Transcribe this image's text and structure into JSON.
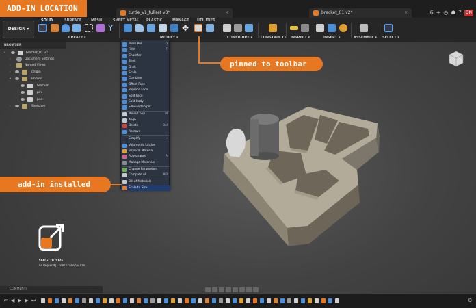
{
  "overlay": {
    "title_callout": "ADD-IN LOCATION",
    "toolbar_callout": "pinned to toolbar",
    "menu_callout": "add-in installed"
  },
  "tabs": {
    "doc1": "turtle_v1_fullset v3*",
    "doc2": "bracket_01 v2*"
  },
  "title_right": {
    "counter": "6",
    "on_badge": "ON"
  },
  "toolbar": {
    "workspace_button": "DESIGN",
    "workspace_tabs": [
      "SOLID",
      "SURFACE",
      "MESH",
      "SHEET METAL",
      "PLASTIC",
      "MANAGE",
      "UTILITIES"
    ],
    "groups": [
      "CREATE",
      "MODIFY",
      "CONFIGURE",
      "CONSTRUCT",
      "INSPECT",
      "INSERT",
      "ASSEMBLE",
      "SELECT"
    ]
  },
  "browser": {
    "header": "BROWSER",
    "root": "bracket_01 v2",
    "items": [
      "Document Settings",
      "Named Views",
      "Origin",
      "Bodies",
      "bracket",
      "pin",
      "pad",
      "Sketches"
    ]
  },
  "modify_menu": [
    {
      "label": "Press Pull",
      "shortcut": "Q",
      "color": "#4a8fd8"
    },
    {
      "label": "Fillet",
      "shortcut": "F",
      "color": "#4a8fd8"
    },
    {
      "label": "Chamfer",
      "shortcut": "",
      "color": "#4a8fd8"
    },
    {
      "label": "Shell",
      "shortcut": "",
      "color": "#4a8fd8"
    },
    {
      "label": "Draft",
      "shortcut": "",
      "color": "#4a8fd8"
    },
    {
      "label": "Scale",
      "shortcut": "",
      "color": "#4a8fd8"
    },
    {
      "label": "Combine",
      "shortcut": "",
      "color": "#4a8fd8"
    },
    {
      "label": "Offset Face",
      "shortcut": "",
      "color": "#4a8fd8"
    },
    {
      "label": "Replace Face",
      "shortcut": "",
      "color": "#4a8fd8"
    },
    {
      "label": "Split Face",
      "shortcut": "",
      "color": "#4a8fd8"
    },
    {
      "label": "Split Body",
      "shortcut": "",
      "color": "#4a8fd8"
    },
    {
      "label": "Silhouette Split",
      "shortcut": "",
      "color": "#4a8fd8"
    },
    {
      "label": "Move/Copy",
      "shortcut": "M",
      "color": "#c8c8c8"
    },
    {
      "label": "Align",
      "shortcut": "",
      "color": "#c8c8c8"
    },
    {
      "label": "Delete",
      "shortcut": "Del",
      "color": "#d84040"
    },
    {
      "label": "Remove",
      "shortcut": "",
      "color": "#4a8fd8"
    },
    {
      "label": "Simplify",
      "shortcut": "›",
      "color": "#2d3441"
    },
    {
      "label": "Volumetric Lattice",
      "shortcut": "",
      "color": "#4a8fd8"
    },
    {
      "label": "Physical Material",
      "shortcut": "",
      "color": "#e0a030"
    },
    {
      "label": "Appearance",
      "shortcut": "A",
      "color": "#d86090"
    },
    {
      "label": "Manage Materials",
      "shortcut": "",
      "color": "#8a8a8a"
    },
    {
      "label": "Change Parameters",
      "shortcut": "",
      "color": "#6ab04c"
    },
    {
      "label": "Compute All",
      "shortcut": "⌘B",
      "color": "#c8c8c8"
    },
    {
      "label": "Bill of Materials",
      "shortcut": "",
      "color": "#c8c8c8"
    },
    {
      "label": "Scale to Size",
      "shortcut": "",
      "color": "#e87722"
    }
  ],
  "logo": {
    "title": "SCALE TO SIZE",
    "url": "nalagrendj.com/scaletosize"
  },
  "bottom": {
    "comments": "COMMENTS"
  },
  "colors": {
    "accent": "#e87722",
    "menu_bg": "#2d3441",
    "highlight": "#1f3c6e"
  }
}
